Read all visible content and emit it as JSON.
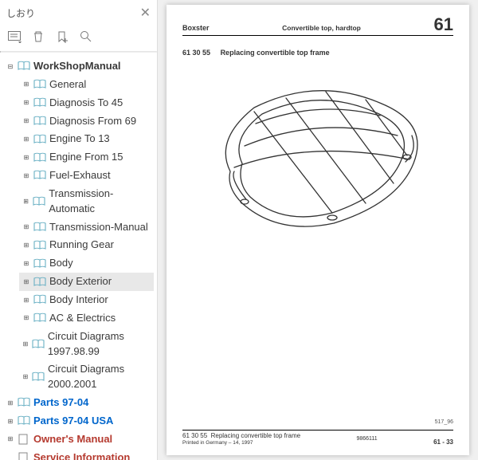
{
  "sidebar": {
    "header_title": "しおり",
    "root": "WorkShopManual",
    "children": [
      "General",
      "Diagnosis To 45",
      "Diagnosis From 69",
      "Engine To 13",
      "Engine From 15",
      "Fuel-Exhaust",
      "Transmission-Automatic",
      "Transmission-Manual",
      "Running Gear",
      "Body",
      "Body Exterior",
      "Body Interior",
      "AC & Electrics",
      "Circuit Diagrams 1997.98.99",
      "Circuit Diagrams 2000.2001"
    ],
    "siblings": [
      {
        "label": "Parts 97-04"
      },
      {
        "label": "Parts 97-04 USA"
      },
      {
        "label": "Owner's Manual"
      },
      {
        "label": "Service Information"
      }
    ]
  },
  "page": {
    "head_left": "Boxster",
    "head_mid": "Convertible top, hardtop",
    "head_right": "61",
    "title_code": "61 30 55",
    "title_text": "Replacing convertible top frame",
    "fig_no": "517_96",
    "foot_code": "61 30 55",
    "foot_text": "Replacing convertible top frame",
    "foot_print": "Printed in Germany – 14, 1997",
    "foot_mid": "9866111",
    "foot_right": "61 - 33"
  }
}
